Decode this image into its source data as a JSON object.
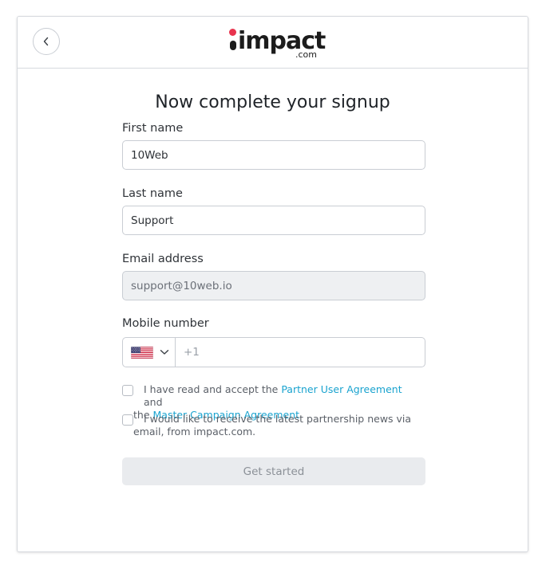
{
  "brand": {
    "name": "impact",
    "suffix": ".com",
    "colors": {
      "dot": "#e8344e",
      "text": "#1c1c1c",
      "link": "#1aa3cf"
    }
  },
  "header": {
    "back_icon": "chevron-left-icon"
  },
  "form": {
    "title": "Now complete your signup",
    "first_name": {
      "label": "First name",
      "value": "10Web"
    },
    "last_name": {
      "label": "Last name",
      "value": "Support"
    },
    "email": {
      "label": "Email address",
      "value": "support@10web.io",
      "disabled": true
    },
    "mobile": {
      "label": "Mobile number",
      "country_flag": "us-flag-icon",
      "dropdown_icon": "chevron-down-icon",
      "placeholder": "+1",
      "value": ""
    },
    "agreement": {
      "prefix": "I have read and accept the",
      "link1": "Partner User Agreement",
      "middle": "and",
      "lead": "the",
      "link2": "Master Campaign Agreement",
      "checked": false
    },
    "newsletter": {
      "line1": "I would like to receive the latest partnership news via",
      "line2": "email, from impact.com.",
      "checked": false
    },
    "submit_label": "Get started"
  }
}
